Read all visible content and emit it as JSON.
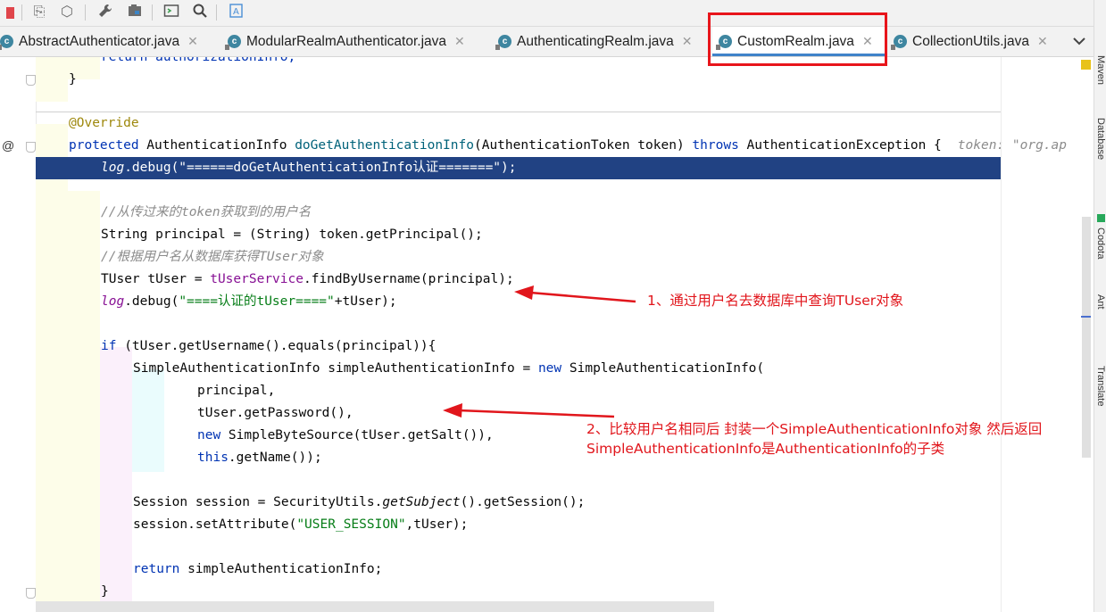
{
  "tabs": [
    {
      "label": "AbstractAuthenticator.java",
      "icon": "class-icon"
    },
    {
      "label": "ModularRealmAuthenticator.java",
      "icon": "class-icon"
    },
    {
      "label": "AuthenticatingRealm.java",
      "icon": "class-icon"
    },
    {
      "label": "CustomRealm.java",
      "icon": "class-icon",
      "active": true
    },
    {
      "label": "CollectionUtils.java",
      "icon": "class-icon"
    }
  ],
  "toolbar_icons": [
    "stop-icon",
    "build-icon",
    "deploy-icon",
    "wrench-icon",
    "project-structure-icon",
    "terminal-icon",
    "search-icon",
    "translate-icon"
  ],
  "right_tool_windows": [
    "Maven",
    "Database",
    "Codota",
    "Ant",
    "Translate"
  ],
  "editor": {
    "inlay_hint": "token: \"org.ap",
    "lines": {
      "l1": "return authorizationInfo;",
      "l2": "}",
      "l3": "@Override",
      "l4_kw": "protected",
      "l4_type": " AuthenticationInfo ",
      "l4_name": "doGetAuthenticationInfo",
      "l4_rest": "(AuthenticationToken token) ",
      "l4_throws": "throws",
      "l4_exc": " AuthenticationException {",
      "l5_log": "log",
      "l5_rest": ".debug(\"======doGetAuthenticationInfo认证=======\");",
      "l6": "//从传过来的token获取到的用户名",
      "l7": "String principal = (String) token.getPrincipal();",
      "l8": "//根据用户名从数据库获得TUser对象",
      "l9_a": "TUser tUser = ",
      "l9_b": "tUserService",
      "l9_c": ".findByUsername(principal);",
      "l10_log": "log",
      "l10_a": ".debug(",
      "l10_str": "\"====认证的tUser====\"",
      "l10_b": "+tUser);",
      "l11_if": "if",
      "l11_rest": " (tUser.getUsername().equals(principal)){",
      "l12_a": "SimpleAuthenticationInfo simpleAuthenticationInfo = ",
      "l12_new": "new",
      "l12_b": " SimpleAuthenticationInfo(",
      "l13": "principal,",
      "l14": "tUser.getPassword(),",
      "l15_new": "new",
      "l15_rest": " SimpleByteSource(tUser.getSalt()),",
      "l16_this": "this",
      "l16_rest": ".getName());",
      "l17_a": "Session session = SecurityUtils.",
      "l17_m": "getSubject",
      "l17_b": "().getSession();",
      "l18_a": "session.setAttribute(",
      "l18_str": "\"USER_SESSION\"",
      "l18_b": ",tUser);",
      "l19_ret": "return",
      "l19_rest": " simpleAuthenticationInfo;",
      "l20": "}"
    }
  },
  "annotations": {
    "note1": "1、通过用户名去数据库中查询TUser对象",
    "note2_line1": "2、比较用户名相同后 封装一个SimpleAuthenticationInfo对象 然后返回",
    "note2_line2": "SimpleAuthenticationInfo是AuthenticationInfo的子类"
  },
  "colors": {
    "keyword": "#0033b3",
    "string": "#067d17",
    "field": "#871094",
    "annotation": "#9e880d",
    "selection": "#214283",
    "callout": "#e1161c"
  }
}
